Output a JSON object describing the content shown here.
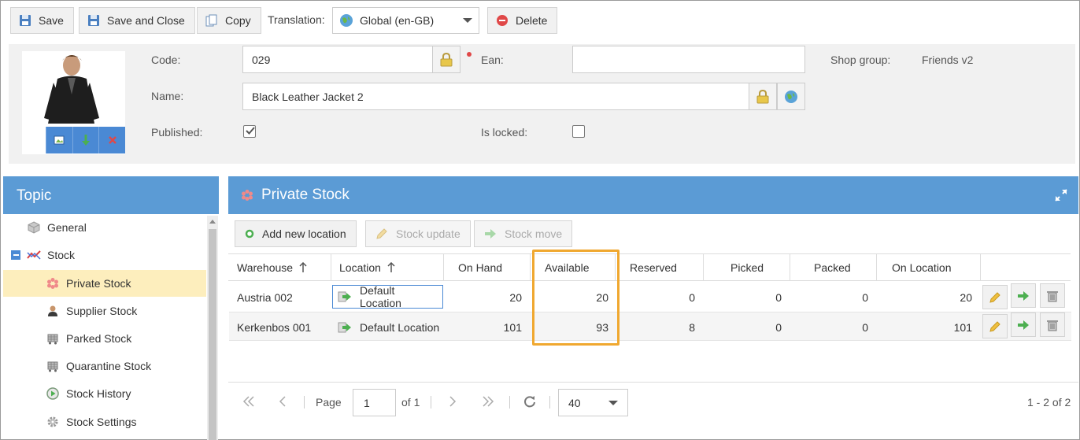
{
  "toolbar": {
    "save": "Save",
    "save_close": "Save and Close",
    "copy": "Copy",
    "translation_label": "Translation:",
    "translation_value": "Global (en-GB)",
    "delete": "Delete"
  },
  "form": {
    "code_label": "Code:",
    "code_value": "029",
    "ean_label": "Ean:",
    "ean_value": "",
    "shop_group_label": "Shop group:",
    "shop_group_value": "Friends v2",
    "name_label": "Name:",
    "name_value": "Black Leather Jacket 2",
    "published_label": "Published:",
    "published": true,
    "locked_label": "Is locked:",
    "locked": false
  },
  "topic": {
    "title": "Topic",
    "items": [
      {
        "label": "General",
        "icon": "cube-icon"
      },
      {
        "label": "Stock",
        "icon": "stock-chart-icon"
      },
      {
        "label": "Private Stock",
        "icon": "asterisk-icon"
      },
      {
        "label": "Supplier Stock",
        "icon": "supplier-icon"
      },
      {
        "label": "Parked Stock",
        "icon": "cart-icon"
      },
      {
        "label": "Quarantine Stock",
        "icon": "cart-icon"
      },
      {
        "label": "Stock History",
        "icon": "play-circle-icon"
      },
      {
        "label": "Stock Settings",
        "icon": "gear-icon"
      }
    ]
  },
  "main": {
    "title": "Private Stock",
    "actions": {
      "add": "Add new location",
      "update": "Stock update",
      "move": "Stock move"
    },
    "columns": [
      "Warehouse",
      "Location",
      "On Hand",
      "Available",
      "Reserved",
      "Picked",
      "Packed",
      "On Location"
    ],
    "rows": [
      {
        "warehouse": "Austria 002",
        "location": "Default Location",
        "on_hand": "20",
        "available": "20",
        "reserved": "0",
        "picked": "0",
        "packed": "0",
        "on_location": "20"
      },
      {
        "warehouse": "Kerkenbos 001",
        "location": "Default Location",
        "on_hand": "101",
        "available": "93",
        "reserved": "8",
        "picked": "0",
        "packed": "0",
        "on_location": "101"
      }
    ]
  },
  "pager": {
    "page_label": "Page",
    "page_value": "1",
    "of_label": "of 1",
    "page_size": "40",
    "summary": "1 - 2 of 2"
  },
  "colors": {
    "accent": "#5b9bd5",
    "selected_bg": "#fdeebd",
    "highlight": "#f0a830"
  }
}
